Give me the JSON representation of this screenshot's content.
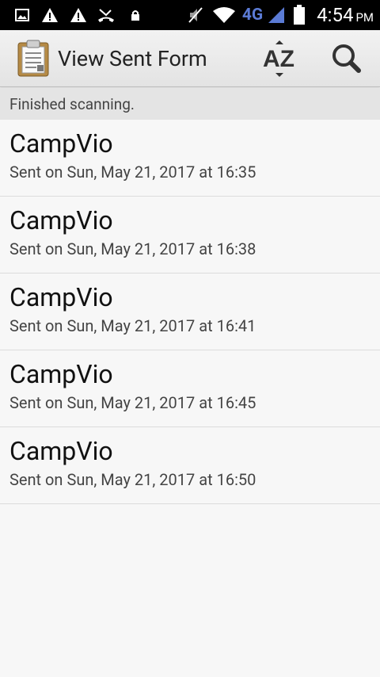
{
  "status_bar": {
    "time": "4:54",
    "ampm": "PM",
    "network": "4G",
    "icons": [
      "image-icon",
      "warning-icon",
      "warning-icon",
      "missed-call-icon",
      "lock-icon",
      "mute-icon",
      "wifi-icon",
      "signal-icon",
      "battery-icon"
    ]
  },
  "action_bar": {
    "title": "View Sent Form",
    "sort_label": "AZ"
  },
  "scan_status": "Finished scanning.",
  "forms": [
    {
      "name": "CampVio",
      "sent": "Sent on Sun, May 21, 2017 at 16:35"
    },
    {
      "name": "CampVio",
      "sent": "Sent on Sun, May 21, 2017 at 16:38"
    },
    {
      "name": "CampVio",
      "sent": "Sent on Sun, May 21, 2017 at 16:41"
    },
    {
      "name": "CampVio",
      "sent": "Sent on Sun, May 21, 2017 at 16:45"
    },
    {
      "name": "CampVio",
      "sent": "Sent on Sun, May 21, 2017 at 16:50"
    }
  ],
  "colors": {
    "network_accent": "#5b7bd5",
    "text_primary": "#111111"
  }
}
